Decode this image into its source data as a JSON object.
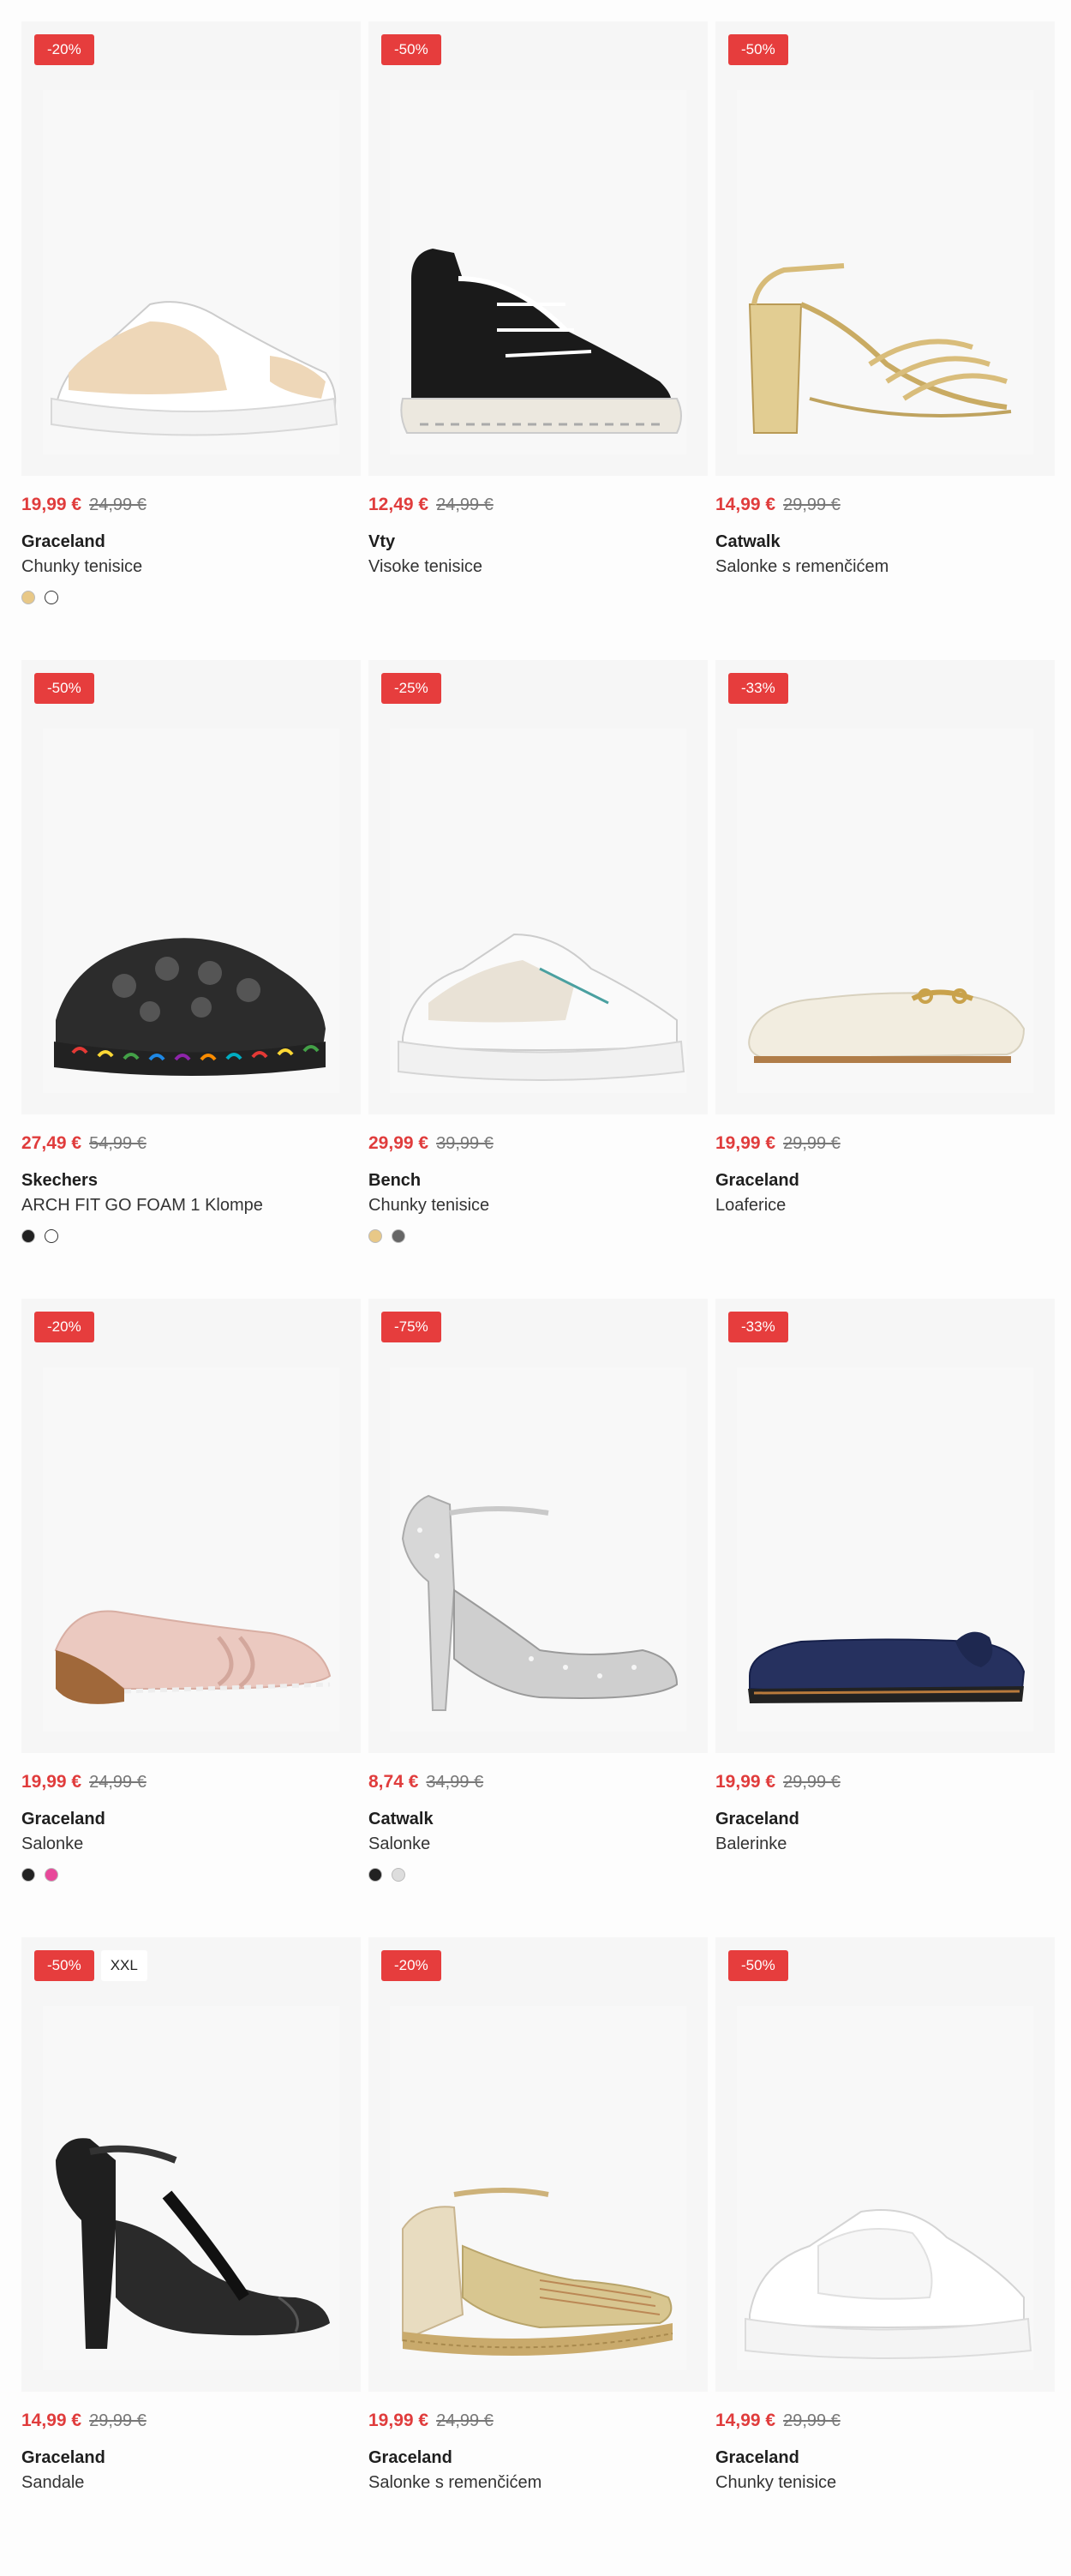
{
  "colors": {
    "accent": "#e63d3d",
    "price": "#e03c3c"
  },
  "products": [
    {
      "discount": "-20%",
      "extra_badge": "",
      "price": "19,99 €",
      "old_price": "24,99 €",
      "brand": "Graceland",
      "name": "Chunky tenisice",
      "swatches": [
        "#e8c887",
        "#ffffff"
      ],
      "shoe": "sneaker-beige-icon"
    },
    {
      "discount": "-50%",
      "extra_badge": "",
      "price": "12,49 €",
      "old_price": "24,99 €",
      "brand": "Vty",
      "name": "Visoke tenisice",
      "swatches": [],
      "shoe": "high-top-black-icon"
    },
    {
      "discount": "-50%",
      "extra_badge": "",
      "price": "14,99 €",
      "old_price": "29,99 €",
      "brand": "Catwalk",
      "name": "Salonke s remenčićem",
      "swatches": [],
      "shoe": "gold-sandal-heel-icon"
    },
    {
      "discount": "-50%",
      "extra_badge": "",
      "price": "27,49 €",
      "old_price": "54,99 €",
      "brand": "Skechers",
      "name": "ARCH FIT GO FOAM 1 Klompe",
      "swatches": [
        "#222222",
        "#ffffff"
      ],
      "shoe": "black-clog-icon"
    },
    {
      "discount": "-25%",
      "extra_badge": "",
      "price": "29,99 €",
      "old_price": "39,99 €",
      "brand": "Bench",
      "name": "Chunky tenisice",
      "swatches": [
        "#e8c887",
        "#666666"
      ],
      "shoe": "sneaker-grey-icon"
    },
    {
      "discount": "-33%",
      "extra_badge": "",
      "price": "19,99 €",
      "old_price": "29,99 €",
      "brand": "Graceland",
      "name": "Loaferice",
      "swatches": [],
      "shoe": "cream-loafer-icon"
    },
    {
      "discount": "-20%",
      "extra_badge": "",
      "price": "19,99 €",
      "old_price": "24,99 €",
      "brand": "Graceland",
      "name": "Salonke",
      "swatches": [
        "#222222",
        "#e8489a"
      ],
      "shoe": "pink-wedge-icon"
    },
    {
      "discount": "-75%",
      "extra_badge": "",
      "price": "8,74 €",
      "old_price": "34,99 €",
      "brand": "Catwalk",
      "name": "Salonke",
      "swatches": [
        "#222222",
        "#dddddd"
      ],
      "shoe": "silver-glitter-heel-icon"
    },
    {
      "discount": "-33%",
      "extra_badge": "",
      "price": "19,99 €",
      "old_price": "29,99 €",
      "brand": "Graceland",
      "name": "Balerinke",
      "swatches": [],
      "shoe": "navy-ballerina-icon"
    },
    {
      "discount": "-50%",
      "extra_badge": "XXL",
      "price": "14,99 €",
      "old_price": "29,99 €",
      "brand": "Graceland",
      "name": "Sandale",
      "swatches": [],
      "shoe": "black-heel-sandal-icon"
    },
    {
      "discount": "-20%",
      "extra_badge": "",
      "price": "19,99 €",
      "old_price": "24,99 €",
      "brand": "Graceland",
      "name": "Salonke s remenčićem",
      "swatches": [],
      "shoe": "espadrille-wedge-icon"
    },
    {
      "discount": "-50%",
      "extra_badge": "",
      "price": "14,99 €",
      "old_price": "29,99 €",
      "brand": "Graceland",
      "name": "Chunky tenisice",
      "swatches": [],
      "shoe": "sneaker-white-icon"
    }
  ]
}
